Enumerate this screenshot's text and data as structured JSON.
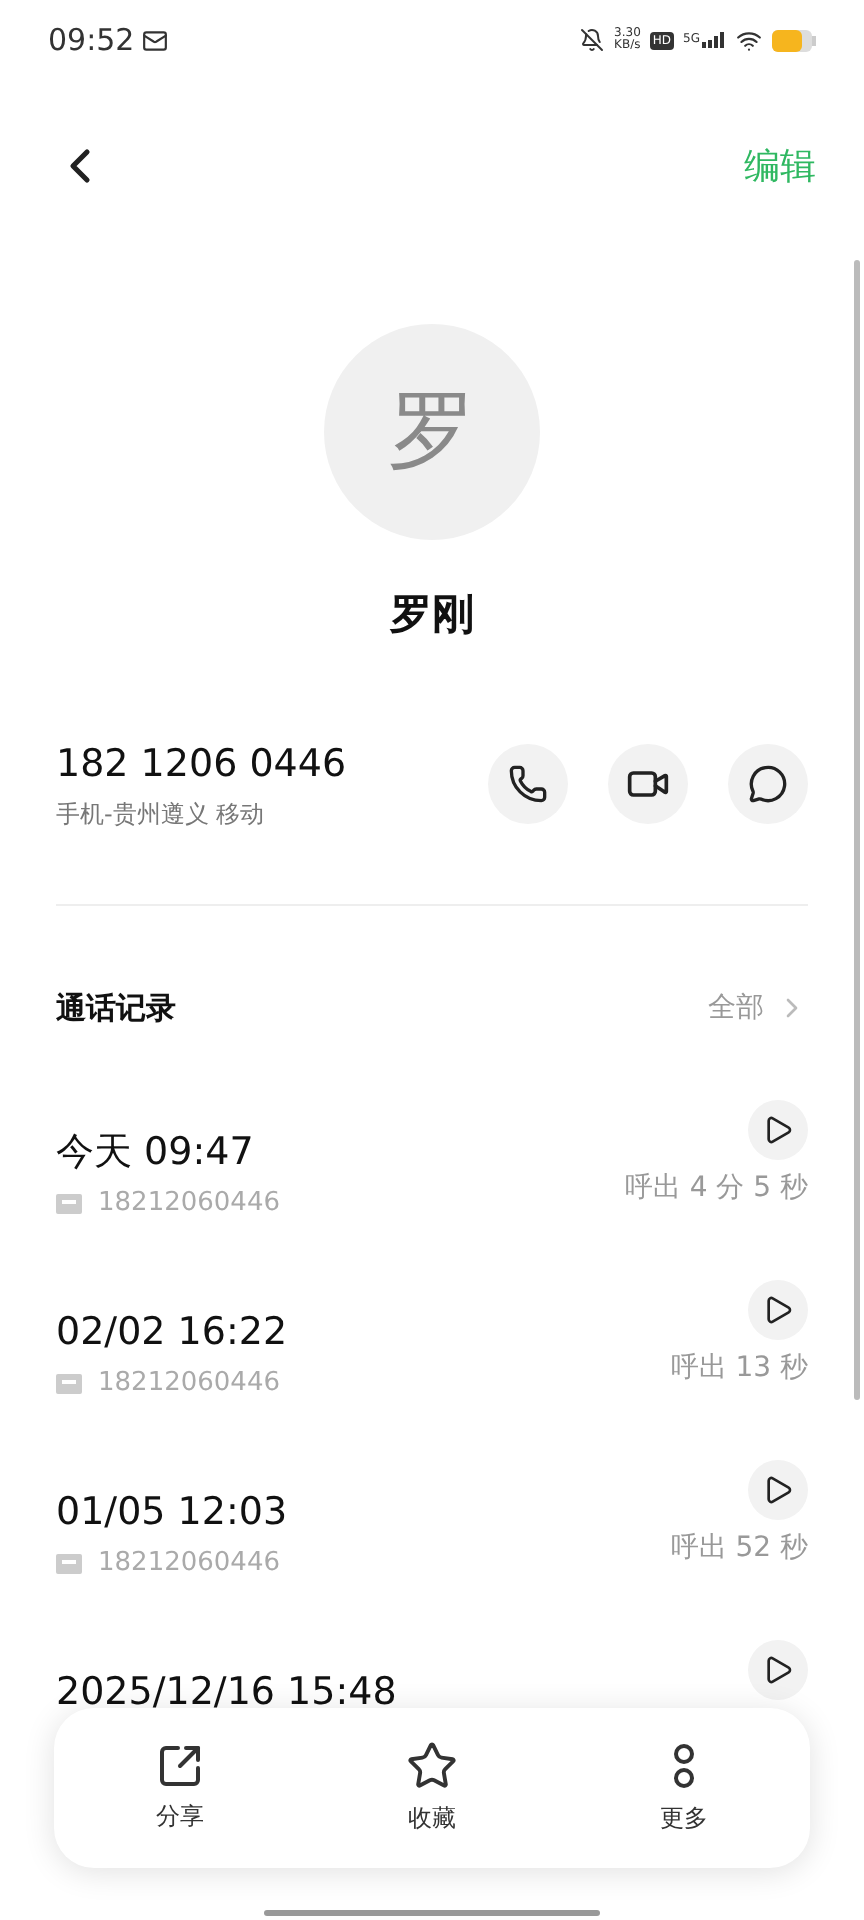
{
  "status_bar": {
    "time": "09:52",
    "speed": "3.30",
    "speed_unit": "KB/s",
    "hd": "HD",
    "network": "5G"
  },
  "header": {
    "edit": "编辑"
  },
  "contact": {
    "avatar_letter": "罗",
    "name": "罗刚",
    "phone": "182 1206 0446",
    "location": "手机-贵州遵义 移动"
  },
  "call_log": {
    "title": "通话记录",
    "all": "全部",
    "rows": [
      {
        "time": "今天 09:47",
        "number": "18212060446",
        "duration": "呼出 4 分 5 秒"
      },
      {
        "time": "02/02 16:22",
        "number": "18212060446",
        "duration": "呼出 13 秒"
      },
      {
        "time": "01/05 12:03",
        "number": "18212060446",
        "duration": "呼出 52 秒"
      },
      {
        "time": "2025/12/16 15:48"
      }
    ]
  },
  "toolbar": [
    {
      "kind": "share",
      "label": "分享"
    },
    {
      "kind": "favorite",
      "label": "收藏"
    },
    {
      "kind": "more",
      "label": "更多"
    }
  ]
}
